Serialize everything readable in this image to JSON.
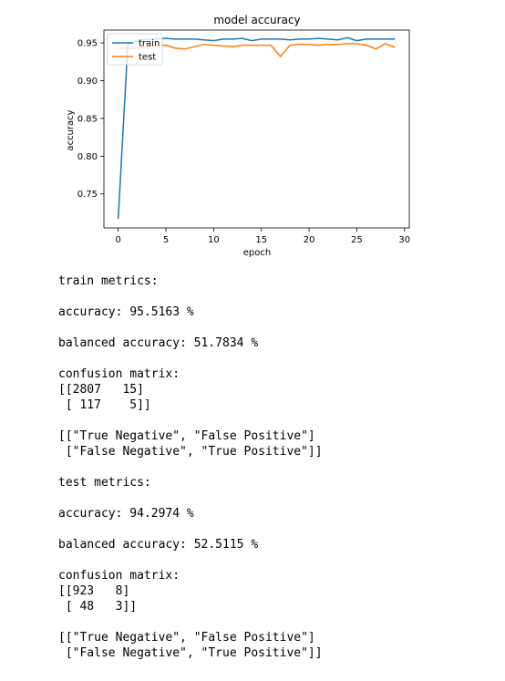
{
  "chart_data": {
    "type": "line",
    "title": "model accuracy",
    "xlabel": "epoch",
    "ylabel": "accuracy",
    "xlim": [
      -1.5,
      30.5
    ],
    "ylim": [
      0.705,
      0.967
    ],
    "x_ticks": [
      0,
      5,
      10,
      15,
      20,
      25,
      30
    ],
    "y_ticks": [
      0.75,
      0.8,
      0.85,
      0.9,
      0.95
    ],
    "grid": false,
    "legend": "upper left",
    "series": [
      {
        "name": "train",
        "color": "#1f77b4",
        "x": [
          0,
          1,
          2,
          3,
          4,
          5,
          6,
          7,
          8,
          9,
          10,
          11,
          12,
          13,
          14,
          15,
          16,
          17,
          18,
          19,
          20,
          21,
          22,
          23,
          24,
          25,
          26,
          27,
          28,
          29
        ],
        "values": [
          0.717,
          0.948,
          0.953,
          0.955,
          0.955,
          0.956,
          0.955,
          0.955,
          0.955,
          0.954,
          0.953,
          0.955,
          0.955,
          0.956,
          0.953,
          0.955,
          0.955,
          0.955,
          0.954,
          0.955,
          0.955,
          0.956,
          0.955,
          0.954,
          0.957,
          0.953,
          0.955,
          0.955,
          0.955,
          0.955
        ]
      },
      {
        "name": "test",
        "color": "#ff7f0e",
        "x": [
          0,
          1,
          2,
          3,
          4,
          5,
          6,
          7,
          8,
          9,
          10,
          11,
          12,
          13,
          14,
          15,
          16,
          17,
          18,
          19,
          20,
          21,
          22,
          23,
          24,
          25,
          26,
          27,
          28,
          29
        ],
        "values": [
          0.943,
          0.943,
          0.943,
          0.945,
          0.947,
          0.947,
          0.943,
          0.942,
          0.945,
          0.948,
          0.947,
          0.946,
          0.945,
          0.947,
          0.947,
          0.947,
          0.947,
          0.932,
          0.947,
          0.948,
          0.948,
          0.947,
          0.948,
          0.948,
          0.949,
          0.949,
          0.947,
          0.942,
          0.949,
          0.944
        ]
      }
    ]
  },
  "output_lines": [
    "train metrics:",
    "",
    "accuracy: 95.5163 %",
    "",
    "balanced accuracy: 51.7834 %",
    "",
    "confusion matrix:",
    "[[2807   15]",
    " [ 117    5]]",
    "",
    "[[\"True Negative\", \"False Positive\"]",
    " [\"False Negative\", \"True Positive\"]]",
    "",
    "test metrics:",
    "",
    "accuracy: 94.2974 %",
    "",
    "balanced accuracy: 52.5115 %",
    "",
    "confusion matrix:",
    "[[923   8]",
    " [ 48   3]]",
    "",
    "[[\"True Negative\", \"False Positive\"]",
    " [\"False Negative\", \"True Positive\"]]"
  ]
}
